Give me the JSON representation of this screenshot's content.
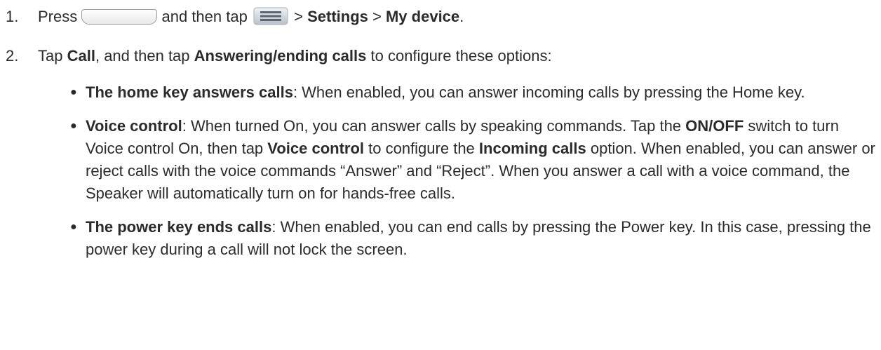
{
  "step1": {
    "number": "1.",
    "press": "Press",
    "and_then_tap": "and then tap",
    "sep1": ">",
    "settings": "Settings",
    "sep2": ">",
    "my_device": "My device",
    "period": ".",
    "home_key_icon": "home-key-icon",
    "menu_icon": "menu-key-icon"
  },
  "step2": {
    "number": "2.",
    "tap": "Tap",
    "call": "Call",
    "and_then_tap": ", and then tap",
    "answering": "Answering/ending calls",
    "rest": "to configure these options:"
  },
  "bullets": [
    {
      "segments": [
        {
          "text": "The home key answers calls",
          "bold": true
        },
        {
          "text": ": When enabled, you can answer incoming calls by pressing the Home key.",
          "bold": false
        }
      ]
    },
    {
      "segments": [
        {
          "text": "Voice control",
          "bold": true
        },
        {
          "text": ": When turned On, you can answer calls by speaking commands. Tap the ",
          "bold": false
        },
        {
          "text": "ON/OFF",
          "bold": true
        },
        {
          "text": " switch to turn Voice control On, then tap ",
          "bold": false
        },
        {
          "text": "Voice control",
          "bold": true
        },
        {
          "text": " to configure the ",
          "bold": false
        },
        {
          "text": "Incoming calls",
          "bold": true
        },
        {
          "text": " option. When enabled, you can answer or reject calls with the voice commands “Answer” and “Reject”. When you answer a call with a voice command, the Speaker will automatically turn on for hands-free calls.",
          "bold": false
        }
      ]
    },
    {
      "segments": [
        {
          "text": "The power key ends calls",
          "bold": true
        },
        {
          "text": ": When enabled, you can end calls by pressing the Power key. In this case, pressing the power key during a call will not lock the screen.",
          "bold": false
        }
      ]
    }
  ],
  "bullet_glyph": "●"
}
